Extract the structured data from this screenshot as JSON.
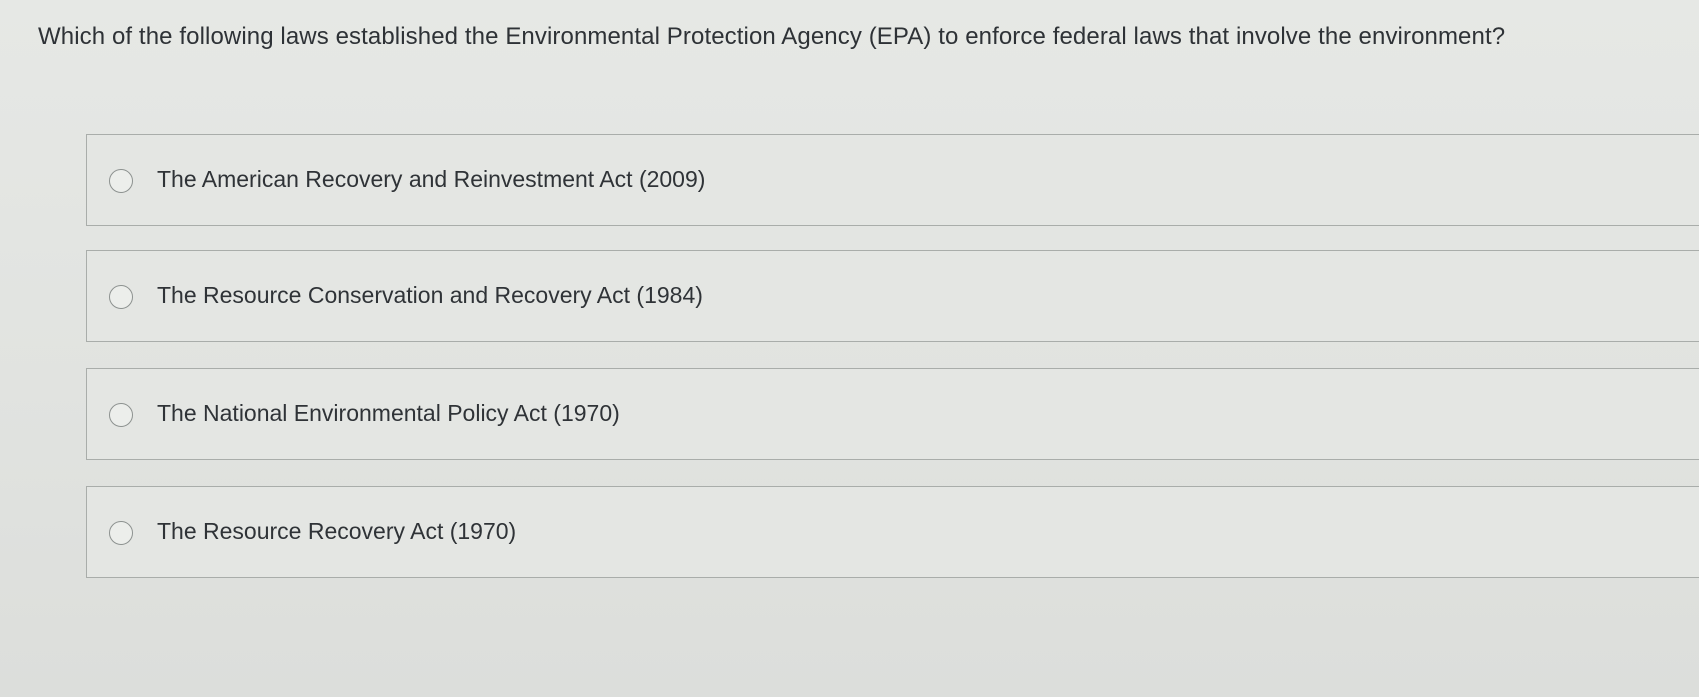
{
  "question": {
    "text": "Which of the following laws established the Environmental Protection Agency (EPA) to enforce federal laws that involve the environment?"
  },
  "options": [
    {
      "label": "The American Recovery and Reinvestment Act (2009)",
      "selected": false
    },
    {
      "label": "The Resource Conservation and Recovery Act (1984)",
      "selected": false
    },
    {
      "label": "The National Environmental Policy Act (1970)",
      "selected": false
    },
    {
      "label": "The Resource Recovery Act (1970)",
      "selected": false
    }
  ]
}
